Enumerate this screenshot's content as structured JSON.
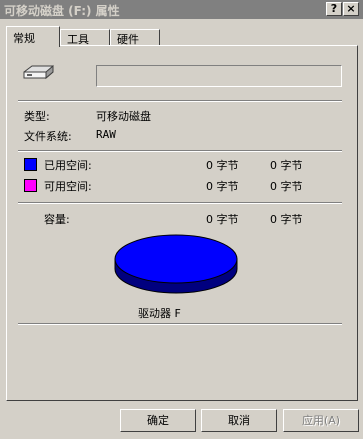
{
  "window": {
    "title": "可移动磁盘 (F:) 属性",
    "help_glyph": "?",
    "close_glyph": "×"
  },
  "tabs": [
    {
      "label": "常规"
    },
    {
      "label": "工具"
    },
    {
      "label": "硬件"
    }
  ],
  "general": {
    "drive_icon": "removable-drive-icon",
    "name_value": "",
    "type_label": "类型:",
    "type_value": "可移动磁盘",
    "fs_label": "文件系统:",
    "fs_value": "RAW",
    "used": {
      "label": "已用空间:",
      "bytes": "0 字节",
      "size": "0 字节",
      "color": "#0000ff"
    },
    "free": {
      "label": "可用空间:",
      "bytes": "0 字节",
      "size": "0 字节",
      "color": "#ff00ff"
    },
    "capacity": {
      "label": "容量:",
      "bytes": "0 字节",
      "size": "0 字节"
    },
    "pie_used_fraction": 1.0,
    "drive_label": "驱动器 F"
  },
  "buttons": {
    "ok": "确定",
    "cancel": "取消",
    "apply": "应用(A)"
  },
  "colors": {
    "pie_top": "#0000ff",
    "pie_side": "#00007f"
  }
}
